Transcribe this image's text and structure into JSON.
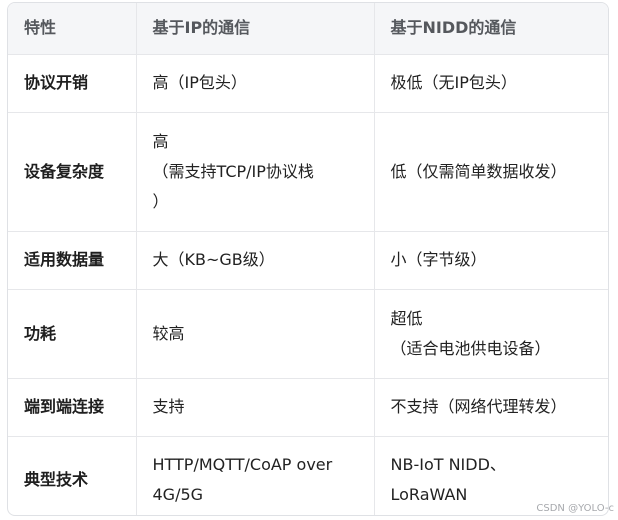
{
  "table": {
    "headers": [
      "特性",
      "基于IP的通信",
      "基于NIDD的通信"
    ],
    "rows": [
      {
        "feature": "协议开销",
        "ip": [
          "高（IP包头）"
        ],
        "nidd": [
          "极低（无IP包头）"
        ]
      },
      {
        "feature": "设备复杂度",
        "ip": [
          "高",
          "（需支持TCP/IP协议栈",
          "）"
        ],
        "nidd": [
          "低（仅需简单数据收发）"
        ]
      },
      {
        "feature": "适用数据量",
        "ip": [
          "大（KB~GB级）"
        ],
        "nidd": [
          "小（字节级）"
        ]
      },
      {
        "feature": "功耗",
        "ip": [
          "较高"
        ],
        "nidd": [
          "超低",
          "（适合电池供电设备）"
        ]
      },
      {
        "feature": "端到端连接",
        "ip": [
          "支持"
        ],
        "nidd": [
          "不支持（网络代理转发）"
        ]
      },
      {
        "feature": "典型技术",
        "ip": [
          "HTTP/MQTT/CoAP over",
          "4G/5G"
        ],
        "nidd": [
          "NB-IoT NIDD、",
          "LoRaWAN"
        ]
      }
    ]
  },
  "watermark": "CSDN @YOLO-c"
}
